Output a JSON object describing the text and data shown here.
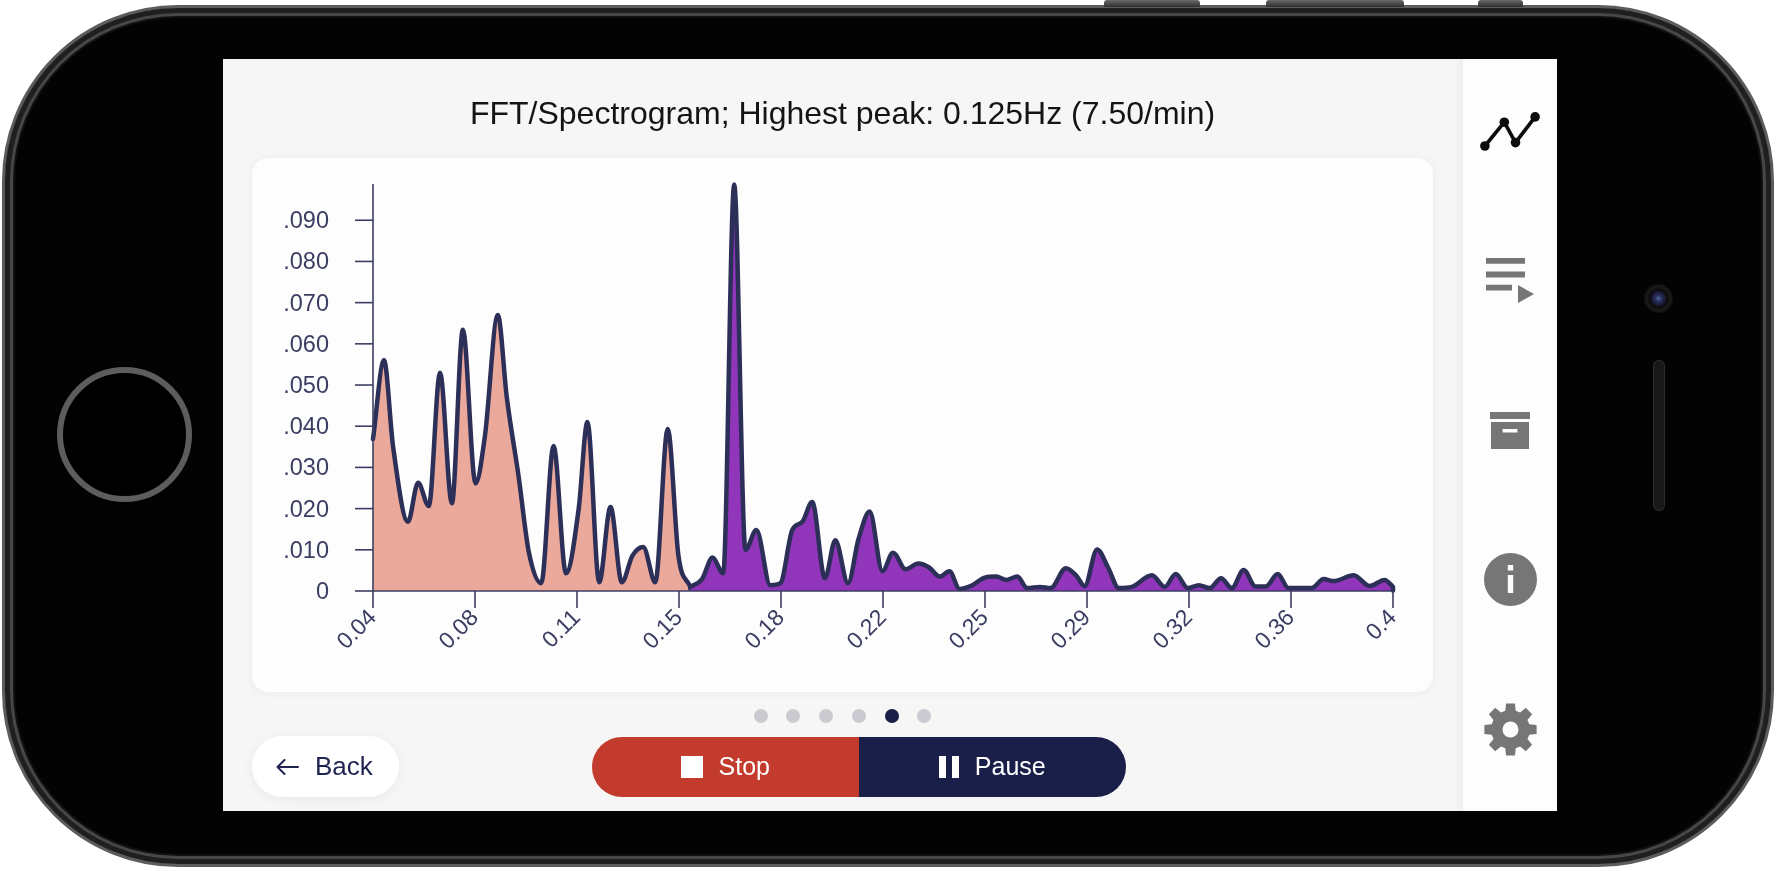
{
  "title": "FFT/Spectrogram; Highest peak: 0.125Hz (7.50/min)",
  "chart": {
    "chart_data": {
      "type": "area",
      "x": [
        0.0423,
        0.0461,
        0.0492,
        0.0544,
        0.0579,
        0.0616,
        0.0655,
        0.0696,
        0.0734,
        0.0778,
        0.081,
        0.0855,
        0.0886,
        0.0927,
        0.0962,
        0.1005,
        0.1048,
        0.1091,
        0.1135,
        0.1165,
        0.1206,
        0.1245,
        0.1284,
        0.1321,
        0.1358,
        0.14,
        0.1443,
        0.148,
        0.1521,
        0.1562,
        0.1598,
        0.1635,
        0.1673,
        0.1712,
        0.175,
        0.1798,
        0.1833,
        0.1874,
        0.1909,
        0.1943,
        0.1987,
        0.2023,
        0.2067,
        0.2103,
        0.2142,
        0.2186,
        0.2223,
        0.2266,
        0.2311,
        0.2348,
        0.2384,
        0.2418,
        0.2453,
        0.2497,
        0.2538,
        0.258,
        0.2615,
        0.2653,
        0.2687,
        0.2731,
        0.2768,
        0.2821,
        0.2856,
        0.2886,
        0.2929,
        0.2967,
        0.3004,
        0.3049,
        0.3119,
        0.3163,
        0.3201,
        0.3243,
        0.3281,
        0.3319,
        0.3358,
        0.3395,
        0.3436,
        0.3477,
        0.3513,
        0.3554,
        0.3591,
        0.3672,
        0.3713,
        0.3747,
        0.3817,
        0.3872,
        0.3924,
        0.3953
      ],
      "series": [
        {
          "color": "#eba99b",
          "values": [
            0.0369,
            0.056,
            0.0354,
            0.0168,
            0.0263,
            0.0206,
            0.053,
            0.0213,
            0.0634,
            0.0261,
            0.0374,
            0.067,
            0.047,
            0.0278,
            0.0096,
            0.0019,
            0.0352,
            0.0043,
            0.02,
            0.041,
            0.0021,
            0.0204,
            0.0021,
            0.0086,
            0.0107,
            0.0021,
            0.0393,
            0.0086,
            0.001,
            null,
            null,
            null,
            null,
            null,
            null,
            null,
            null,
            null,
            null,
            null,
            null,
            null,
            null,
            null,
            null,
            null,
            null,
            null,
            null,
            null,
            null,
            null,
            null,
            null,
            null,
            null,
            null,
            null,
            null,
            null,
            null,
            null,
            null,
            null,
            null,
            null,
            null,
            null,
            null,
            null,
            null,
            null,
            null,
            null,
            null,
            null,
            null,
            null,
            null,
            null,
            null,
            null,
            null,
            null,
            null,
            null,
            null,
            null
          ]
        },
        {
          "color": "#9136bb",
          "values": [
            null,
            null,
            null,
            null,
            null,
            null,
            null,
            null,
            null,
            null,
            null,
            null,
            null,
            null,
            null,
            null,
            null,
            null,
            null,
            null,
            null,
            null,
            null,
            null,
            null,
            null,
            null,
            null,
            0.001,
            0.0029,
            0.0081,
            0.0043,
            0.0987,
            0.01,
            0.0148,
            0.0014,
            0.0019,
            0.0148,
            0.0168,
            0.0216,
            0.0031,
            0.0123,
            0.0019,
            0.0125,
            0.0193,
            0.0048,
            0.0093,
            0.0053,
            0.0067,
            0.0057,
            0.0035,
            0.0048,
            0.0005,
            0.0014,
            0.0032,
            0.0035,
            0.0027,
            0.0035,
            0.0007,
            0.001,
            0.0007,
            0.0055,
            0.0038,
            0.0012,
            0.0101,
            0.0057,
            0.0007,
            0.001,
            0.0038,
            0.001,
            0.0041,
            0.0007,
            0.0014,
            0.0007,
            0.0031,
            0.0007,
            0.0051,
            0.0011,
            0.0011,
            0.0041,
            0.0007,
            0.0007,
            0.0029,
            0.0024,
            0.0038,
            0.0012,
            0.0027,
            0.001
          ]
        }
      ],
      "xlim": [
        0.0423,
        0.3953
      ],
      "ylim": [
        0,
        0.0988
      ],
      "xticks": [
        {
          "value": 0.0423,
          "label": "0.04"
        },
        {
          "value": 0.0776,
          "label": "0.08"
        },
        {
          "value": 0.1129,
          "label": "0.11"
        },
        {
          "value": 0.1482,
          "label": "0.15"
        },
        {
          "value": 0.1835,
          "label": "0.18"
        },
        {
          "value": 0.2188,
          "label": "0.22"
        },
        {
          "value": 0.2541,
          "label": "0.25"
        },
        {
          "value": 0.2894,
          "label": "0.29"
        },
        {
          "value": 0.3247,
          "label": "0.32"
        },
        0.36,
        {
          "value": 0.3953,
          "label": "0.4"
        }
      ],
      "yticks": [
        0,
        {
          "value": 0.01,
          "label": ".010"
        },
        {
          "value": 0.02,
          "label": ".020"
        },
        {
          "value": 0.03,
          "label": ".030"
        },
        {
          "value": 0.04,
          "label": ".040"
        },
        {
          "value": 0.05,
          "label": ".050"
        },
        {
          "value": 0.06,
          "label": ".060"
        },
        {
          "value": 0.07,
          "label": ".070"
        },
        {
          "value": 0.08,
          "label": ".080"
        },
        {
          "value": 0.09,
          "label": ".090"
        }
      ]
    }
  },
  "pager": [
    {
      "selected": false
    },
    {
      "selected": false
    },
    {
      "selected": false
    },
    {
      "selected": false
    },
    {
      "selected": true
    },
    {
      "selected": false
    }
  ],
  "back_button": {
    "label": "Back"
  },
  "controls": [
    {
      "kind": "stop",
      "label": "Stop"
    },
    {
      "kind": "pause",
      "label": "Pause"
    }
  ],
  "sidebar": {
    "items": [
      {
        "kind": "chart",
        "selected": true
      },
      {
        "kind": "playlist",
        "selected": false
      },
      {
        "kind": "archive",
        "selected": false
      },
      {
        "kind": "info",
        "selected": false
      },
      {
        "kind": "settings",
        "selected": false
      }
    ]
  }
}
